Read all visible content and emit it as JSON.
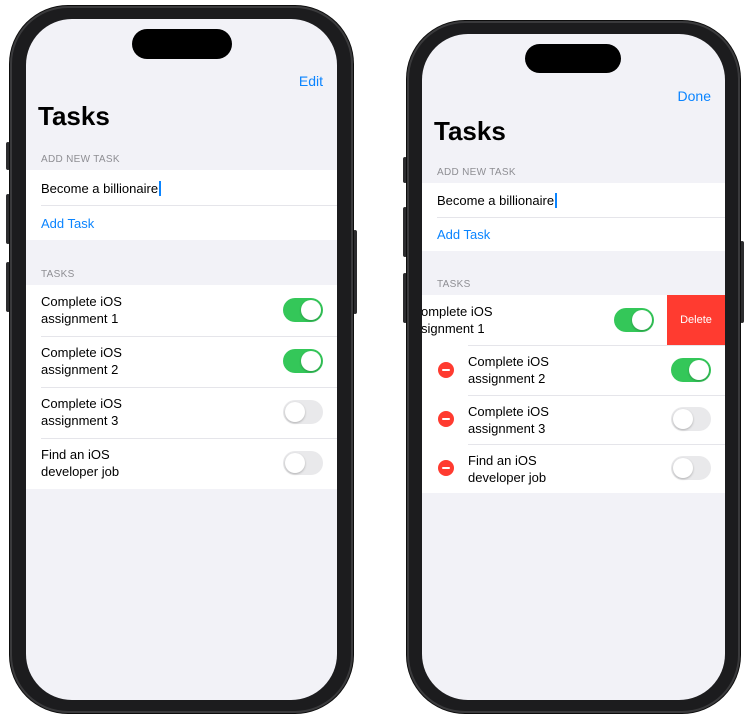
{
  "left_screen": {
    "nav_button": "Edit",
    "title": "Tasks",
    "add_section_header": "ADD NEW TASK",
    "new_task_value": "Become a billionaire",
    "add_task_label": "Add Task",
    "tasks_section_header": "TASKS",
    "tasks": [
      {
        "title": "Complete iOS\nassignment 1",
        "done": true
      },
      {
        "title": "Complete iOS\nassignment 2",
        "done": true
      },
      {
        "title": "Complete iOS\nassignment 3",
        "done": false
      },
      {
        "title": "Find an iOS\ndeveloper job",
        "done": false
      }
    ]
  },
  "right_screen": {
    "nav_button": "Done",
    "title": "Tasks",
    "add_section_header": "ADD NEW TASK",
    "new_task_value": "Become a billionaire",
    "add_task_label": "Add Task",
    "tasks_section_header": "TASKS",
    "swiped_task": {
      "title": "omplete iOS\nsignment 1",
      "done": true
    },
    "delete_label": "Delete",
    "tasks": [
      {
        "title": "Complete iOS\nassignment 2",
        "done": true
      },
      {
        "title": "Complete iOS\nassignment 3",
        "done": false
      },
      {
        "title": "Find an iOS\ndeveloper job",
        "done": false
      }
    ]
  },
  "colors": {
    "accent": "#0a84ff",
    "toggle_on": "#34c759",
    "destructive": "#ff3b30",
    "background": "#f2f2f7"
  }
}
